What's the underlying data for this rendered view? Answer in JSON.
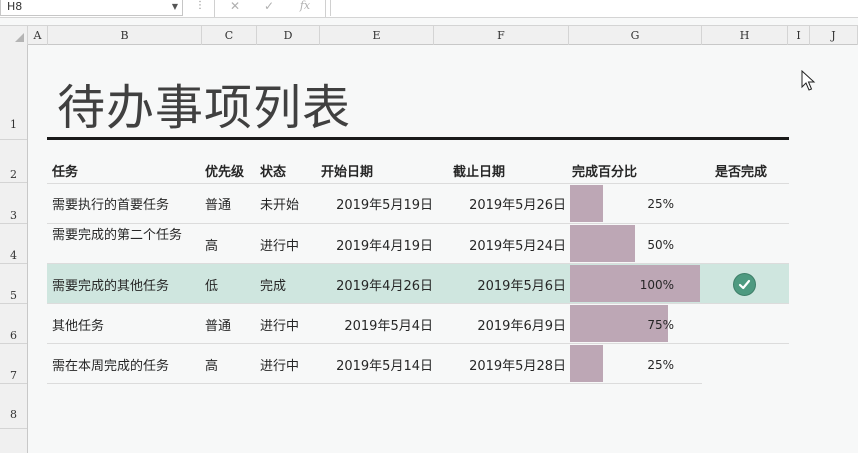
{
  "formula_bar": {
    "name_box": "H8",
    "cancel_icon": "✕",
    "enter_icon": "✓",
    "fx_label": "fx",
    "formula": ""
  },
  "columns": [
    "A",
    "B",
    "C",
    "D",
    "E",
    "F",
    "G",
    "H",
    "I",
    "J"
  ],
  "rows": [
    "1",
    "2",
    "3",
    "4",
    "5",
    "6",
    "7",
    "8"
  ],
  "sheet": {
    "title": "待办事项列表",
    "headers": {
      "task": "任务",
      "priority": "优先级",
      "status": "状态",
      "start": "开始日期",
      "due": "截止日期",
      "percent": "完成百分比",
      "done": "是否完成"
    },
    "tasks": [
      {
        "task": "需要执行的首要任务",
        "priority": "普通",
        "status": "未开始",
        "start": "2019年5月19日",
        "due": "2019年5月26日",
        "percent_label": "25%",
        "percent": 0.25,
        "done": false
      },
      {
        "task": "需要完成的第二个任务",
        "priority": "高",
        "status": "进行中",
        "start": "2019年4月19日",
        "due": "2019年5月24日",
        "percent_label": "50%",
        "percent": 0.5,
        "done": false
      },
      {
        "task": "需要完成的其他任务",
        "priority": "低",
        "status": "完成",
        "start": "2019年4月26日",
        "due": "2019年5月6日",
        "percent_label": "100%",
        "percent": 1.0,
        "done": true
      },
      {
        "task": "其他任务",
        "priority": "普通",
        "status": "进行中",
        "start": "2019年5月4日",
        "due": "2019年6月9日",
        "percent_label": "75%",
        "percent": 0.75,
        "done": false
      },
      {
        "task": "需在本周完成的任务",
        "priority": "高",
        "status": "进行中",
        "start": "2019年5月14日",
        "due": "2019年5月28日",
        "percent_label": "25%",
        "percent": 0.25,
        "done": false
      }
    ]
  },
  "colors": {
    "bar": "#bda7b5",
    "highlight_row": "#cfe6df",
    "check": "#4e9a80"
  }
}
